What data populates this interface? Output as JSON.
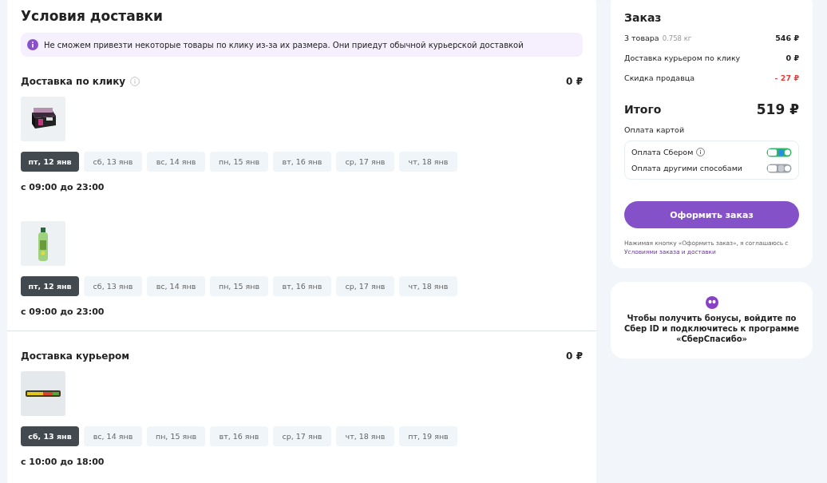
{
  "delivery": {
    "title": "Условия доставки",
    "notice": "Не сможем привезти некоторые товары по клику из-за их размера. Они приедут обычной курьерской доставкой",
    "sections": [
      {
        "title": "Доставка по клику",
        "has_info": true,
        "price": "0 ₽",
        "groups": [
          {
            "dates": [
              {
                "label": "пт, 12 янв",
                "selected": true
              },
              {
                "label": "сб, 13 янв",
                "selected": false
              },
              {
                "label": "вс, 14 янв",
                "selected": false
              },
              {
                "label": "пн, 15 янв",
                "selected": false
              },
              {
                "label": "вт, 16 янв",
                "selected": false
              },
              {
                "label": "ср, 17 янв",
                "selected": false
              },
              {
                "label": "чт, 18 янв",
                "selected": false
              }
            ],
            "time": "с 09:00 до 23:00"
          },
          {
            "dates": [
              {
                "label": "пт, 12 янв",
                "selected": true
              },
              {
                "label": "сб, 13 янв",
                "selected": false
              },
              {
                "label": "вс, 14 янв",
                "selected": false
              },
              {
                "label": "пн, 15 янв",
                "selected": false
              },
              {
                "label": "вт, 16 янв",
                "selected": false
              },
              {
                "label": "ср, 17 янв",
                "selected": false
              },
              {
                "label": "чт, 18 янв",
                "selected": false
              }
            ],
            "time": "с 09:00 до 23:00"
          }
        ]
      },
      {
        "title": "Доставка курьером",
        "has_info": false,
        "price": "0 ₽",
        "groups": [
          {
            "dates": [
              {
                "label": "сб, 13 янв",
                "selected": true
              },
              {
                "label": "вс, 14 янв",
                "selected": false
              },
              {
                "label": "пн, 15 янв",
                "selected": false
              },
              {
                "label": "вт, 16 янв",
                "selected": false
              },
              {
                "label": "ср, 17 янв",
                "selected": false
              },
              {
                "label": "чт, 18 янв",
                "selected": false
              },
              {
                "label": "пт, 19 янв",
                "selected": false
              }
            ],
            "time": "с 10:00 до 18:00"
          }
        ]
      }
    ]
  },
  "order": {
    "title": "Заказ",
    "lines": [
      {
        "label": "3 товара",
        "note": "0.758 кг",
        "value": "546 ₽",
        "kind": "normal"
      },
      {
        "label": "Доставка курьером по клику",
        "value": "0 ₽",
        "kind": "normal"
      },
      {
        "label": "Скидка продавца",
        "value": "- 27 ₽",
        "kind": "discount"
      }
    ],
    "total_label": "Итого",
    "total": "519 ₽",
    "payment_label": "Оплата картой",
    "payment_options": [
      {
        "label": "Оплата Сбером",
        "has_info": true,
        "kind": "sber"
      },
      {
        "label": "Оплата другими способами",
        "has_info": false,
        "kind": "other"
      }
    ],
    "button": "Оформить заказ",
    "agreement": "Нажимая кнопку «Оформить заказ», я соглашаюсь с",
    "agreement_link": "Условиями заказа и доставки"
  },
  "bonus": {
    "text": "Чтобы получить бонусы, войдите по Сбер ID и подключитесь к программе «СберСпасибо»"
  }
}
